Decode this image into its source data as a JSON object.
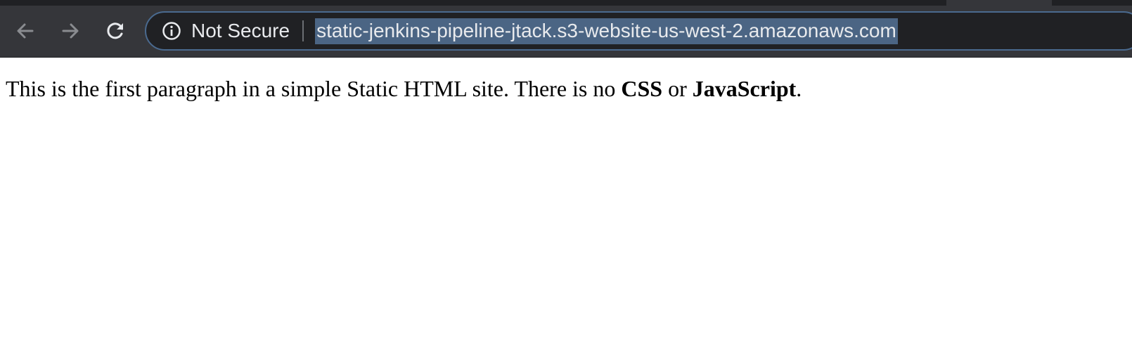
{
  "browser": {
    "security_label": "Not Secure",
    "url": "static-jenkins-pipeline-jtack.s3-website-us-west-2.amazonaws.com",
    "icons": {
      "back": "arrow-left-icon",
      "forward": "arrow-right-icon",
      "reload": "reload-icon",
      "info": "info-icon"
    },
    "colors": {
      "toolbar": "#35363a",
      "omnibox": "#202124",
      "omnibox_border": "#4a6a8f",
      "selection": "#4b6584"
    }
  },
  "page": {
    "paragraph": {
      "text_before": "This is the first paragraph in a simple Static HTML site. There is no ",
      "bold_1": "CSS",
      "text_middle": " or ",
      "bold_2": "JavaScript",
      "text_after": "."
    }
  }
}
